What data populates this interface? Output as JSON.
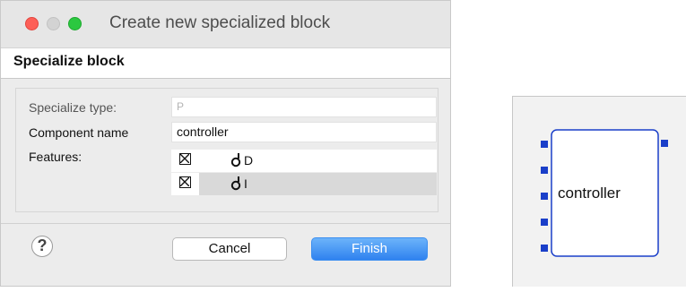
{
  "window": {
    "title": "Create new specialized block",
    "controls": [
      "close-button",
      "minimize-button",
      "maximize-button"
    ]
  },
  "banner": {
    "title": "Specialize block"
  },
  "form": {
    "specialize_type": {
      "label": "Specialize type:",
      "value": "P"
    },
    "component_name": {
      "label": "Component name",
      "value": "controller"
    },
    "features": {
      "label": "Features:",
      "rows": [
        {
          "checked": true,
          "icon": "port-icon",
          "name": "D"
        },
        {
          "checked": true,
          "icon": "port-icon",
          "name": "I"
        }
      ]
    }
  },
  "footer": {
    "help_icon": "question-icon",
    "help_glyph": "?",
    "cancel_label": "Cancel",
    "finish_label": "Finish"
  },
  "diagram": {
    "block_label": "controller",
    "accent_color": "#1a3fc9",
    "left_port_count": 5,
    "right_port_count": 1
  }
}
